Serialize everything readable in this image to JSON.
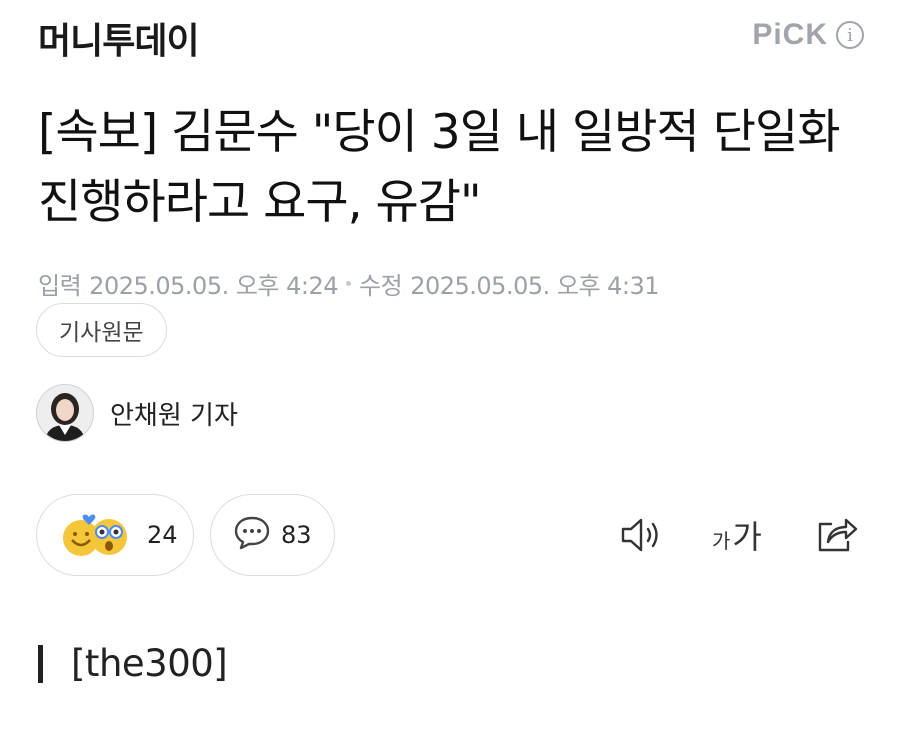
{
  "press": {
    "name": "머니투데이"
  },
  "pick": {
    "label": "PiCK",
    "info_icon": "i"
  },
  "article": {
    "headline": "[속보] 김문수 \"당이 3일 내 일방적 단일화 진행하라고 요구, 유감\"",
    "input_label": "입력",
    "input_date": "2025.05.05. 오후 4:24",
    "edit_label": "수정",
    "edit_date": "2025.05.05. 오후 4:31",
    "original_button": "기사원문"
  },
  "reporter": {
    "name": "안채원 기자"
  },
  "reactions": {
    "count": "24"
  },
  "comments": {
    "count": "83"
  },
  "toolbar": {
    "font_small": "가",
    "font_big": "가"
  },
  "body": {
    "section_tag": "[the300]"
  },
  "colors": {
    "muted": "#9ca1a8",
    "border": "#dadde1",
    "emoji_yellow": "#f5c63a",
    "emoji_blue": "#4e8df5"
  }
}
